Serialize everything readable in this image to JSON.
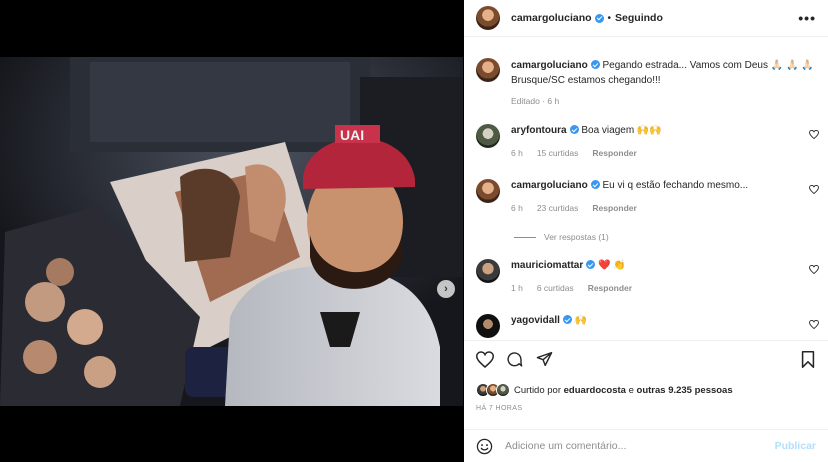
{
  "post": {
    "author": "camargoluciano",
    "follow_status": "Seguindo",
    "more": "•••",
    "separator": "•"
  },
  "caption": {
    "username": "camargoluciano",
    "text": "Pegando estrada... Vamos com Deus 🙏🏻 🙏🏻 🙏🏻 Brusque/SC estamos chegando!!!",
    "meta": "Editado · 6 h"
  },
  "comments": [
    {
      "username": "aryfontoura",
      "text": "Boa viagem 🙌🙌",
      "time": "6 h",
      "likes": "15 curtidas",
      "reply": "Responder",
      "verified": true
    },
    {
      "username": "camargoluciano",
      "text": "Eu vi q estão fechando mesmo...",
      "time": "6 h",
      "likes": "23 curtidas",
      "reply": "Responder",
      "verified": true,
      "replies": "Ver respostas (1)"
    },
    {
      "username": "mauriciomattar",
      "text": "❤️ 👏",
      "time": "1 h",
      "likes": "6 curtidas",
      "reply": "Responder",
      "verified": true
    },
    {
      "username": "yagovidall",
      "text": "🙌",
      "verified": true
    }
  ],
  "likes": {
    "prefix": "Curtido por",
    "user": "eduardocosta",
    "middle": "e",
    "others": "outras 9.235 pessoas"
  },
  "timestamp": "HÁ 7 HORAS",
  "add_comment": {
    "placeholder": "Adicione um comentário...",
    "post": "Publicar"
  },
  "icons": {
    "like": "heart-icon",
    "comment": "comment-icon",
    "share": "share-icon",
    "save": "bookmark-icon",
    "emoji": "emoji-icon",
    "next": "chevron-right-icon"
  },
  "colors": {
    "verified": "#3897f0",
    "secondary_text": "#8e8e8e",
    "publish_disabled": "#b2dffc"
  }
}
